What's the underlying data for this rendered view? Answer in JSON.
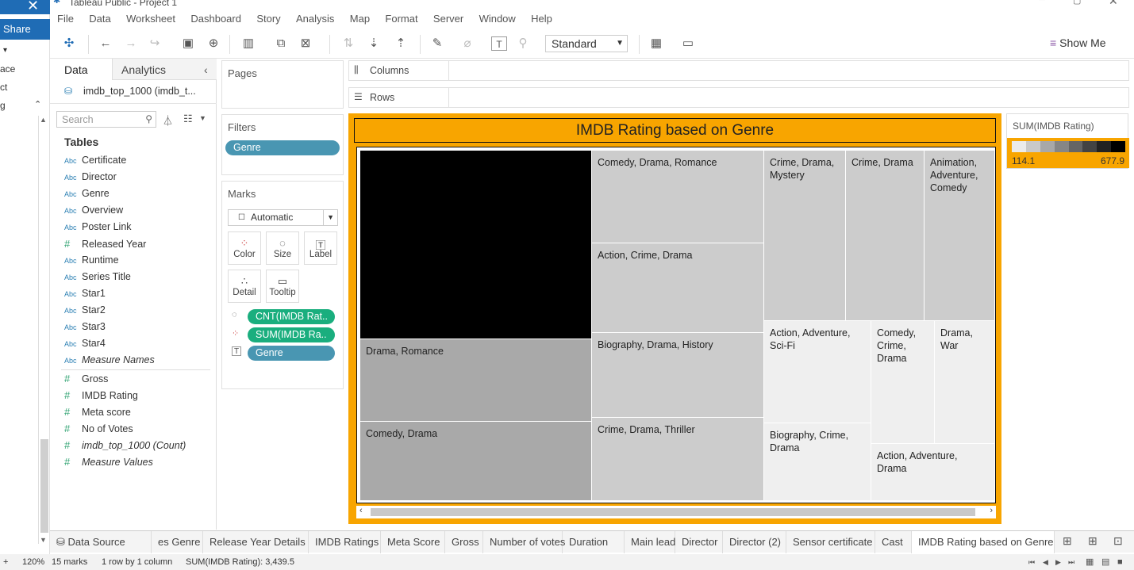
{
  "window": {
    "title": "Tableau Public - Project 1"
  },
  "left_strip": {
    "share": "Share",
    "frag1": "ace",
    "frag2": "ct",
    "frag3": "g"
  },
  "menu": [
    "File",
    "Data",
    "Worksheet",
    "Dashboard",
    "Story",
    "Analysis",
    "Map",
    "Format",
    "Server",
    "Window",
    "Help"
  ],
  "toolbar": {
    "fit": "Standard",
    "show_me": "Show Me"
  },
  "data_pane": {
    "tab_data": "Data",
    "tab_analytics": "Analytics",
    "source": "imdb_top_1000 (imdb_t...",
    "search_placeholder": "Search",
    "tables_header": "Tables",
    "dimensions": [
      {
        "icon": "Abc",
        "name": "Certificate"
      },
      {
        "icon": "Abc",
        "name": "Director"
      },
      {
        "icon": "Abc",
        "name": "Genre"
      },
      {
        "icon": "Abc",
        "name": "Overview"
      },
      {
        "icon": "Abc",
        "name": "Poster Link"
      },
      {
        "icon": "#",
        "name": "Released Year"
      },
      {
        "icon": "Abc",
        "name": "Runtime"
      },
      {
        "icon": "Abc",
        "name": "Series Title"
      },
      {
        "icon": "Abc",
        "name": "Star1"
      },
      {
        "icon": "Abc",
        "name": "Star2"
      },
      {
        "icon": "Abc",
        "name": "Star3"
      },
      {
        "icon": "Abc",
        "name": "Star4"
      },
      {
        "icon": "Abc",
        "name": "Measure Names"
      }
    ],
    "measures": [
      {
        "icon": "#",
        "name": "Gross"
      },
      {
        "icon": "#",
        "name": "IMDB Rating"
      },
      {
        "icon": "#",
        "name": "Meta score"
      },
      {
        "icon": "#",
        "name": "No of Votes"
      },
      {
        "icon": "#",
        "name": "imdb_top_1000 (Count)"
      },
      {
        "icon": "#",
        "name": "Measure Values"
      }
    ]
  },
  "pages": {
    "title": "Pages"
  },
  "filters": {
    "title": "Filters",
    "pill": "Genre"
  },
  "marks": {
    "title": "Marks",
    "type": "Automatic",
    "buttons": [
      "Color",
      "Size",
      "Label",
      "Detail",
      "Tooltip"
    ],
    "pills": [
      "CNT(IMDB Rat..",
      "SUM(IMDB Ra..",
      "Genre"
    ]
  },
  "shelves": {
    "columns": "Columns",
    "rows": "Rows"
  },
  "viz": {
    "title": "IMDB Rating based on Genre",
    "cells": [
      {
        "label": "",
        "color": "#000000"
      },
      {
        "label": "Drama, Romance",
        "color": "#a9a9a9"
      },
      {
        "label": "Comedy, Drama",
        "color": "#a9a9a9"
      },
      {
        "label": "Comedy, Drama, Romance",
        "color": "#cccccc"
      },
      {
        "label": "Action, Crime, Drama",
        "color": "#cccccc"
      },
      {
        "label": "Biography, Drama, History",
        "color": "#cccccc"
      },
      {
        "label": "Crime, Drama, Thriller",
        "color": "#cccccc"
      },
      {
        "label": "Crime, Drama, Mystery",
        "color": "#cccccc"
      },
      {
        "label": "Crime, Drama",
        "color": "#cccccc"
      },
      {
        "label": "Animation, Adventure, Comedy",
        "color": "#cccccc"
      },
      {
        "label": "Action, Adventure, Sci-Fi",
        "color": "#efefef"
      },
      {
        "label": "Comedy, Crime, Drama",
        "color": "#efefef"
      },
      {
        "label": "Drama, War",
        "color": "#efefef"
      },
      {
        "label": "Biography, Crime, Drama",
        "color": "#efefef"
      },
      {
        "label": "Action, Adventure, Drama",
        "color": "#efefef"
      }
    ]
  },
  "legend": {
    "title": "SUM(IMDB Rating)",
    "min": "114.1",
    "max": "677.9"
  },
  "tabs": [
    "Data Source",
    "es Genre",
    "Release Year Details",
    "IMDB Ratings",
    "Meta Score",
    "Gross",
    "Number of votes",
    "Duration",
    "Main lead",
    "Director",
    "Director (2)",
    "Sensor certificate",
    "Cast",
    "IMDB Rating based on Genre"
  ],
  "status": {
    "zoom": "120%",
    "marks": "15 marks",
    "dims": "1 row by 1 column",
    "sum": "SUM(IMDB Rating): 3,439.5"
  }
}
